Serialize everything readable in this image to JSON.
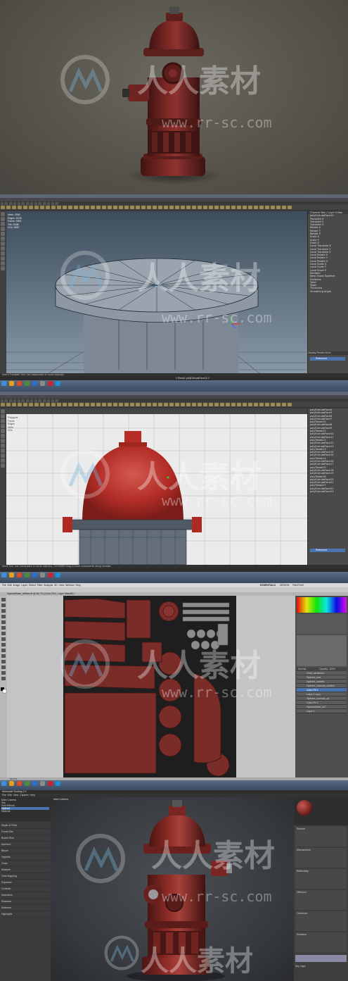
{
  "watermark": {
    "chinese": "人人素材",
    "url": "www.rr-sc.com"
  },
  "maya_perspective": {
    "help_line": "Select Translate Tool: Use manipulator to move object(s)",
    "command_prompt": "// Result: polyExtrudeFace10 //",
    "channel_box_header": "Channel Box / Layer Editor",
    "outliner_items": [
      "polyExtrudeFace10",
      "Translate X",
      "Translate Y",
      "Translate Z",
      "Rotate X",
      "Rotate Y",
      "Rotate Z",
      "Scale X",
      "Scale Y",
      "Scale Z",
      "Local Translate X",
      "Local Translate Y",
      "Local Translate Z",
      "Local Rotate X",
      "Local Rotate Y",
      "Local Rotate Z",
      "Local Scale X",
      "Local Scale Y",
      "Local Scale Z",
      "Random",
      "Keep Faces Together",
      "Divisions",
      "Twist",
      "Taper",
      "Thickness",
      "Smoothing Angle"
    ],
    "layer_tabs": [
      "Display",
      "Render",
      "Anim"
    ],
    "layer_name": "Reference",
    "statsline": [
      [
        "Verts:",
        "3080",
        "0",
        "0"
      ],
      [
        "Edges:",
        "6128",
        "0",
        "0"
      ],
      [
        "Faces:",
        "3063",
        "0",
        "0"
      ],
      [
        "Tris:",
        "5938",
        "0",
        "0"
      ],
      [
        "UVs:",
        "3520",
        "0",
        "0"
      ]
    ]
  },
  "maya_ortho": {
    "uv_panel_items": [
      "Polygons",
      "Faces",
      "Edges",
      "Verts",
      "UVs"
    ],
    "help_line": "Move Tool: Use manipulator to move object(s). Ctrl+MMB+drag to move components along normals.",
    "outliner_items": [
      "polyExtrudeFace4",
      "polyExtrudeFace5",
      "polyExtrudeFace6",
      "polyExtrudeFace7",
      "polyTweak10",
      "polyExtrudeFace8",
      "polyExtrudeFace9",
      "polyTweak11",
      "polyExtrudeFace10",
      "polyExtrudeFace11",
      "polyTweak12",
      "polyExtrudeFace12",
      "polyExtrudeFace13",
      "polyTweak13",
      "polyExtrudeFace14",
      "polyExtrudeFace15",
      "polyTweak14",
      "polyExtrudeFace16",
      "polyExtrudeFace17",
      "polyTweak15",
      "polyExtrudeFace18",
      "polyExtrudeFace19",
      "polyTweak16",
      "polyExtrudeFace20",
      "polyExtrudeFace21",
      "polyTweak17",
      "polyExtrudeFace22",
      "polyExtrudeFace23"
    ],
    "layer_name": "Reference"
  },
  "photoshop": {
    "menu": [
      "File",
      "Edit",
      "Image",
      "Layer",
      "Select",
      "Filter",
      "Analysis",
      "3D",
      "View",
      "Window",
      "Help"
    ],
    "workspaces": [
      "ESSENTIALS",
      "DESIGN",
      "PAINTING"
    ],
    "doc_tab": "HydrantBase_diffuse.tif @ 66.7% (Color Fill 1, Layer Mask/8) *",
    "status": "66.67%",
    "layers": [
      "Paint_scratches",
      "Hydrant_rust",
      "Hydrant_metalic",
      "Hydrant_normals_scratch",
      "Color Fill 1",
      "Layer 1 copy",
      "Hydrant_normals_ao",
      "Color Fill 2",
      "HydrantBase_AO",
      "Layer 1"
    ],
    "layer_mode": "Normal",
    "opacity_label": "Opacity: 100%"
  },
  "marmoset": {
    "window_title": "Marmoset Toolbag 2.0",
    "menu": [
      "File",
      "Edit",
      "View",
      "Capture",
      "Help"
    ],
    "viewport_label": "Main Camera",
    "scene_items": [
      "Main Camera",
      "Sky",
      "Post Effects",
      "Hydrant",
      "Material"
    ],
    "material_sections": [
      "Surface",
      "Microsurface",
      "Reflectivity",
      "Diffusion",
      "Occlusion",
      "Emissive"
    ],
    "left_params": [
      "Depth of Field",
      "Focus Dist",
      "Bokeh Size",
      "Aperture",
      "Bloom",
      "Vignette",
      "Grain",
      "Sharpen",
      "Tone Mapping",
      "Exposure",
      "Contrast",
      "Saturation",
      "Shadows",
      "Midtones",
      "Highlights"
    ],
    "sky_label": "Sky Light"
  },
  "colors": {
    "hydrant_red": "#8a2a28",
    "maya_grid_bg": "#6f7f8f",
    "ortho_bg": "#e9e9e9",
    "uv_bg": "#1e1e1e",
    "selection_blue": "#4a74b0"
  }
}
